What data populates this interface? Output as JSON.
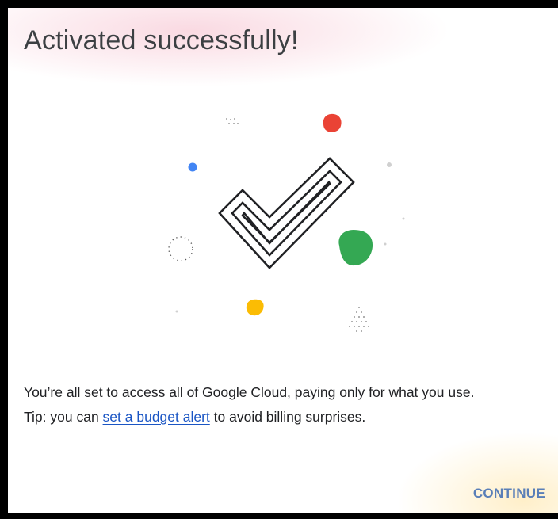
{
  "dialog": {
    "title": "Activated successfully!",
    "message_line1": "You’re all set to access all of Google Cloud, paying only for what you use.",
    "tip_prefix": "Tip: you can ",
    "tip_link": "set a budget alert",
    "tip_suffix": " to avoid billing surprises.",
    "continue_label": "CONTINUE"
  },
  "illustration": {
    "icon": "checkmark-icon",
    "decorations": [
      "red-blob",
      "blue-dot",
      "green-blob",
      "yellow-blob",
      "dotted-circle",
      "dotted-triangle",
      "dot-cluster"
    ],
    "colors": {
      "red": "#ea4335",
      "blue": "#4285f4",
      "green": "#34a853",
      "yellow": "#fbbc04",
      "gray": "#bdbdbd",
      "outline": "#202124"
    }
  },
  "colors": {
    "link": "#1a55c4",
    "button": "#5a7fb8",
    "title": "#3c4043"
  }
}
